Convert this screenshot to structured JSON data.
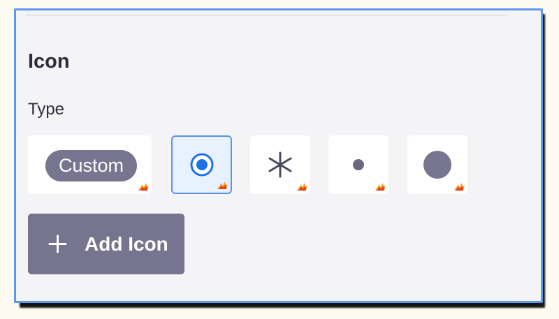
{
  "section": {
    "title": "Icon",
    "type_label": "Type"
  },
  "icon_types": [
    {
      "kind": "custom",
      "label": "Custom",
      "icon": "custom-pill",
      "selected": false
    },
    {
      "kind": "radio",
      "label": "",
      "icon": "radio-button-icon",
      "selected": true
    },
    {
      "kind": "asterisk",
      "label": "",
      "icon": "asterisk-icon",
      "selected": false
    },
    {
      "kind": "small-dot",
      "label": "",
      "icon": "small-dot-icon",
      "selected": false
    },
    {
      "kind": "large-circle",
      "label": "",
      "icon": "large-circle-icon",
      "selected": false
    }
  ],
  "add_button": {
    "label": "Add Icon",
    "icon": "plus-icon"
  },
  "colors": {
    "panel_border": "#5c97ee",
    "selected_bg": "#e8f1ff",
    "accent_blue": "#1f72e6",
    "muted_purple": "#76748e",
    "badge_orange": "#f0a01b"
  }
}
